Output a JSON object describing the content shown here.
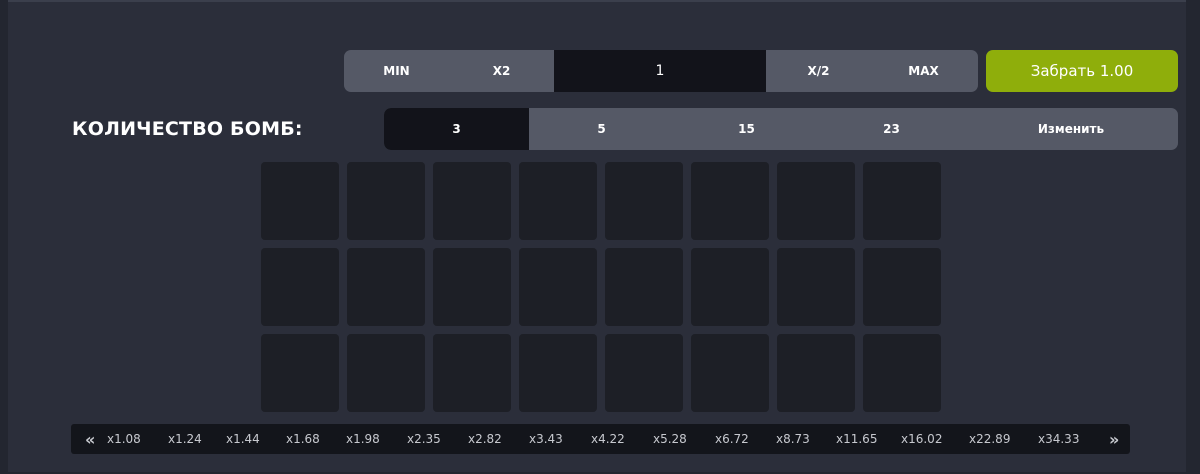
{
  "bet": {
    "min_label": "MIN",
    "x2_label": "X2",
    "value": "1",
    "half_label": "X/2",
    "max_label": "MAX"
  },
  "collect_label": "Забрать 1.00",
  "bombs": {
    "title": "КОЛИЧЕСТВО БОМБ:",
    "options": [
      "3",
      "5",
      "15",
      "23"
    ],
    "selected": "3",
    "change_label": "Изменить"
  },
  "multipliers": [
    "x1.08",
    "x1.24",
    "x1.44",
    "x1.68",
    "x1.98",
    "x2.35",
    "x2.82",
    "x3.43",
    "x4.22",
    "x5.28",
    "x6.72",
    "x8.73",
    "x11.65",
    "x16.02",
    "x22.89",
    "x34.33"
  ],
  "icons": {
    "prev": "double-chevron-left-icon",
    "next": "double-chevron-right-icon"
  },
  "colors": {
    "accent": "#8fae0b",
    "selected": "#12131a",
    "tile": "#1d1f26"
  }
}
